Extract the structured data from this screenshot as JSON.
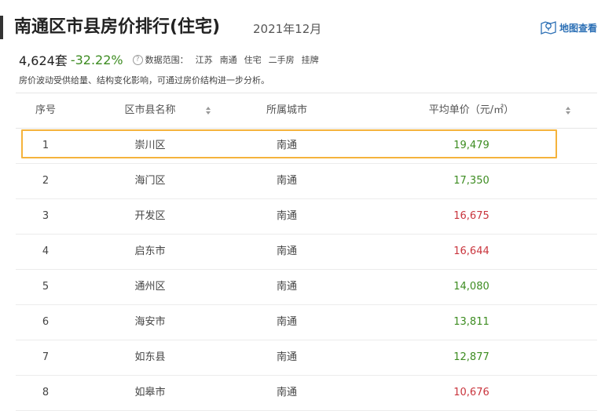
{
  "header": {
    "title": "南通区市县房价排行(住宅)",
    "date": "2021年12月",
    "map_link": "地图查看"
  },
  "stats": {
    "count": "4,624套",
    "change": "-32.22%",
    "help_icon_text": "?",
    "scope_label": "数据范围：",
    "scope": [
      "江苏",
      "南通",
      "住宅",
      "二手房",
      "挂牌"
    ]
  },
  "note": "房价波动受供给量、结构变化影响，可通过房价结构进一步分析。",
  "table": {
    "headers": {
      "rank": "序号",
      "name": "区市县名称",
      "city": "所属城市",
      "price": "平均单价（元/㎡）"
    },
    "rows": [
      {
        "rank": "1",
        "name": "崇川区",
        "city": "南通",
        "price": "19,479",
        "trend": "green"
      },
      {
        "rank": "2",
        "name": "海门区",
        "city": "南通",
        "price": "17,350",
        "trend": "green"
      },
      {
        "rank": "3",
        "name": "开发区",
        "city": "南通",
        "price": "16,675",
        "trend": "red"
      },
      {
        "rank": "4",
        "name": "启东市",
        "city": "南通",
        "price": "16,644",
        "trend": "red"
      },
      {
        "rank": "5",
        "name": "通州区",
        "city": "南通",
        "price": "14,080",
        "trend": "green"
      },
      {
        "rank": "6",
        "name": "海安市",
        "city": "南通",
        "price": "13,811",
        "trend": "green"
      },
      {
        "rank": "7",
        "name": "如东县",
        "city": "南通",
        "price": "12,877",
        "trend": "green"
      },
      {
        "rank": "8",
        "name": "如皋市",
        "city": "南通",
        "price": "10,676",
        "trend": "red"
      }
    ]
  },
  "colors": {
    "up": "#c9353d",
    "down": "#3d8c21",
    "highlight": "#f5b33c",
    "link": "#2b6fb5"
  }
}
